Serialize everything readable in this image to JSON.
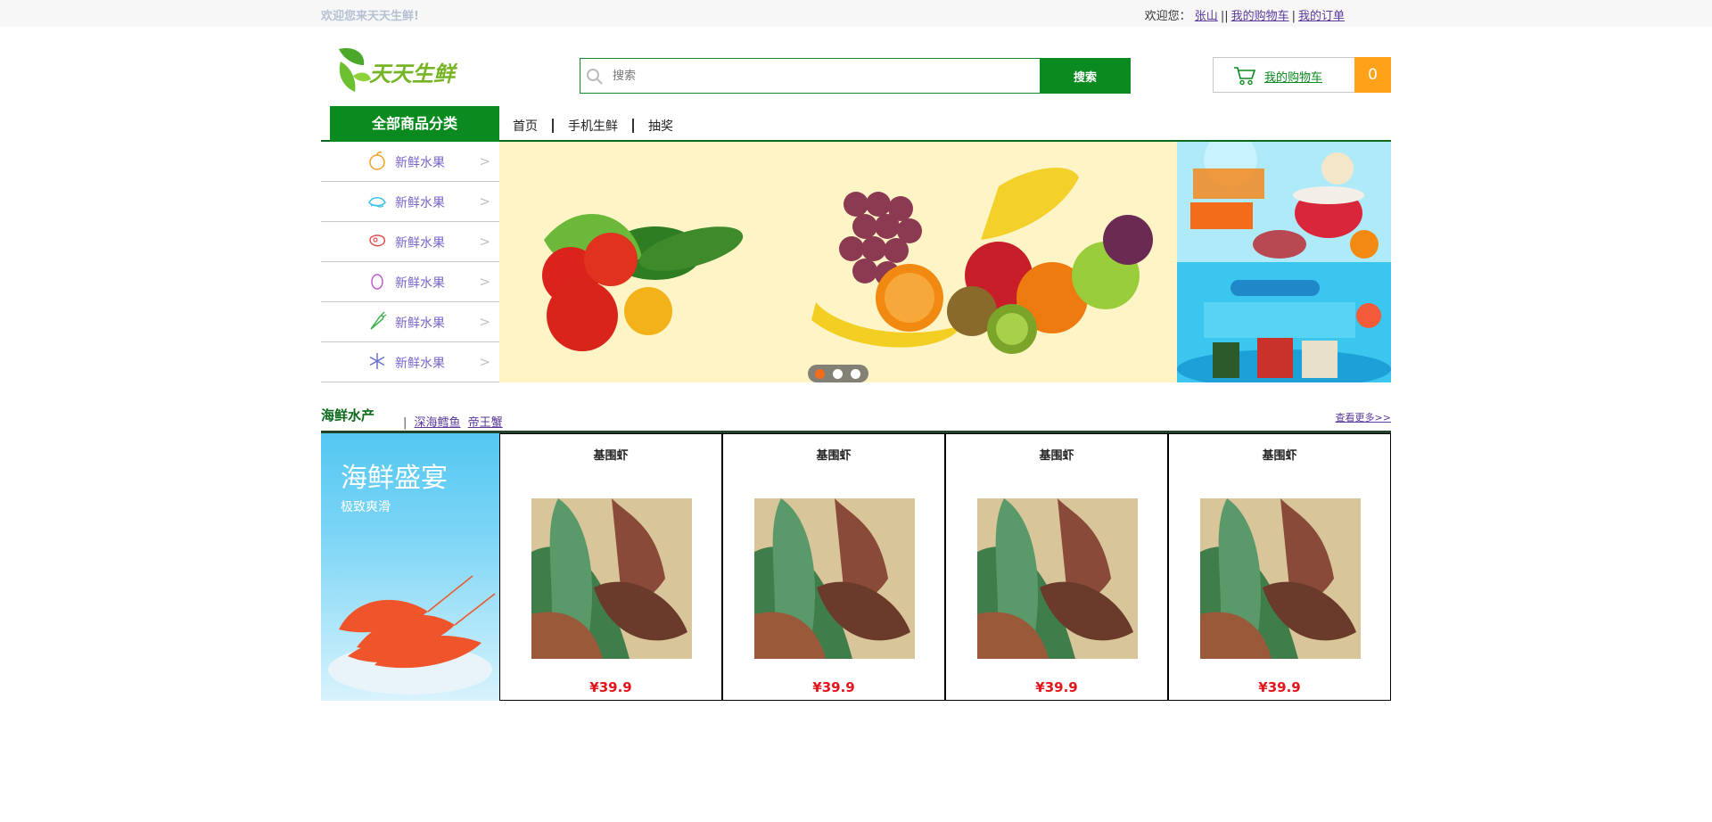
{
  "topbar": {
    "welcome": "欢迎您来天天生鲜!",
    "greeting": "欢迎您：",
    "username": "张山",
    "cart_link": "我的购物车",
    "orders_link": "我的订单"
  },
  "header": {
    "logo_text": "天天生鲜",
    "search_placeholder": "搜索",
    "search_button": "搜索",
    "cart_label": "我的购物车",
    "cart_count": "0"
  },
  "nav": {
    "all_categories": "全部商品分类",
    "links": [
      "首页",
      "手机生鲜",
      "抽奖"
    ]
  },
  "side_menu": [
    {
      "label": "新鲜水果",
      "icon": "orange-icon",
      "color": "#f0a020"
    },
    {
      "label": "新鲜水果",
      "icon": "seafood-icon",
      "color": "#39c3e6"
    },
    {
      "label": "新鲜水果",
      "icon": "meat-icon",
      "color": "#e05050"
    },
    {
      "label": "新鲜水果",
      "icon": "egg-icon",
      "color": "#c05ad0"
    },
    {
      "label": "新鲜水果",
      "icon": "vegetable-icon",
      "color": "#3db050"
    },
    {
      "label": "新鲜水果",
      "icon": "frozen-icon",
      "color": "#6a72c8"
    }
  ],
  "slider": {
    "dots": 3,
    "active_dot": 0
  },
  "section": {
    "title": "海鲜水产",
    "sub_links": [
      "深海鳕鱼",
      "帝王蟹"
    ],
    "more": "查看更多>>",
    "banner_title": "海鲜盛宴",
    "banner_subtitle": "极致爽滑",
    "products": [
      {
        "name": "基围虾",
        "price": "¥39.9"
      },
      {
        "name": "基围虾",
        "price": "¥39.9"
      },
      {
        "name": "基围虾",
        "price": "¥39.9"
      },
      {
        "name": "基围虾",
        "price": "¥39.9"
      }
    ]
  },
  "colors": {
    "brand_green": "#0b8a1f",
    "cart_orange": "#ffa21a",
    "price_red": "#e3141b"
  }
}
